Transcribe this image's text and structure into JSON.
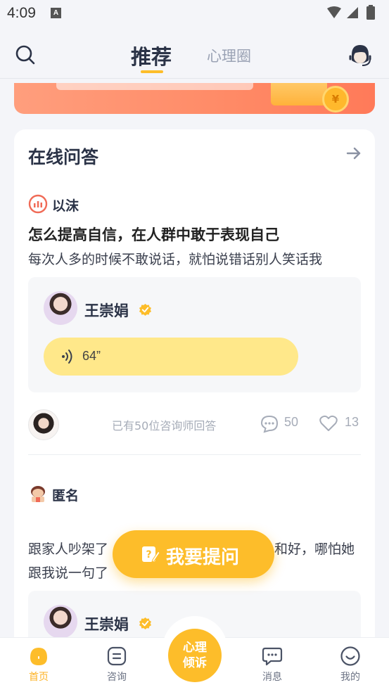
{
  "status_bar": {
    "time": "4:09",
    "notification_letter": "A"
  },
  "header": {
    "tabs": [
      {
        "label": "推荐",
        "active": true
      },
      {
        "label": "心理圈",
        "active": false
      }
    ]
  },
  "card": {
    "title": "在线问答",
    "items": [
      {
        "user": "以沫",
        "title": "怎么提高自信，在人群中敢于表现自己",
        "desc": "每次人多的时候不敢说话，就怕说错话别人笑话我",
        "counselor": "王崇娟",
        "voice_length": "64”",
        "answer_count_text": "已有50位咨询师回答",
        "comments": "50",
        "likes": "13"
      },
      {
        "user": "匿名",
        "desc_line1": "跟家人吵架了",
        "desc_line1_tail": "和好，哪怕她",
        "desc_line2": "跟我说一句了",
        "counselor": "王崇娟"
      }
    ]
  },
  "ask_button": {
    "label": "我要提问"
  },
  "bottom_nav": {
    "items": [
      {
        "label": "首页",
        "icon": "home-icon",
        "active": true
      },
      {
        "label": "咨询",
        "icon": "consult-icon",
        "active": false
      },
      {
        "label": "消息",
        "icon": "message-icon",
        "active": false
      },
      {
        "label": "我的",
        "icon": "profile-icon",
        "active": false
      }
    ],
    "center": {
      "line1": "心理",
      "line2": "倾诉"
    }
  },
  "colors": {
    "accent": "#fdbd2a",
    "title": "#2b3347",
    "muted": "#a6acb8",
    "banner": "#ff8a66",
    "voice": "#ffe88a"
  }
}
